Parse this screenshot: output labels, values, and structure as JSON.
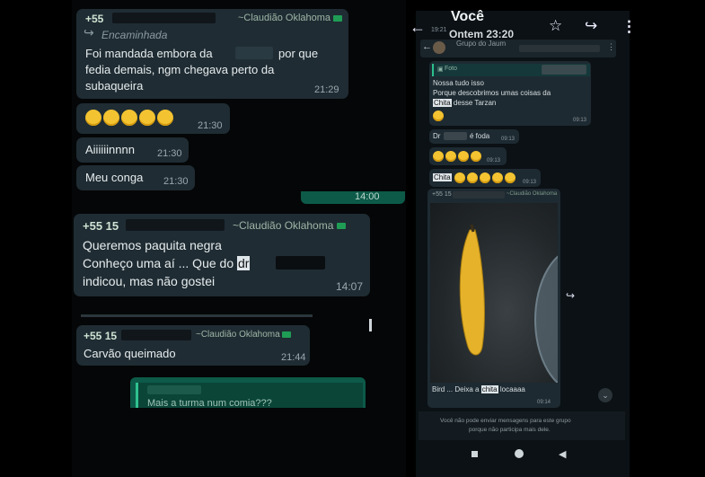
{
  "left_chat": {
    "msg1": {
      "sender": "+55",
      "contact": "~Claudião Oklahoma",
      "forwarded": "Encaminhada",
      "line1": "Foi mandada embora da",
      "line1_end": "por que",
      "line2": "fedia demais, ngm chegava perto da",
      "line3": "subaqueira",
      "time": "21:29"
    },
    "msg2": {
      "time": "21:30"
    },
    "msg3": {
      "text": "Aiiiiiinnnn",
      "time": "21:30"
    },
    "msg4": {
      "text": "Meu conga",
      "time": "21:30"
    },
    "msg_out_time": "14:00",
    "msg5": {
      "sender": "+55 15",
      "contact": "~Claudião Oklahoma",
      "line1": "Queremos paquita negra",
      "line2": "Conheço uma aí ... Que do",
      "line2_hl": "dr",
      "line3": "indicou, mas não gostei",
      "time": "14:07"
    },
    "msg6": {
      "sender": "+55 15",
      "contact": "~Claudião Oklahoma",
      "text": "Carvão queimado",
      "time": "21:44"
    },
    "msg7": {
      "text": "Mais a turma num comia???"
    }
  },
  "phone": {
    "title": "Você",
    "subtitle": "Ontem 23:20",
    "status_time": "19:21",
    "group_name": "Grupo do Jaum",
    "foto_label": "Foto",
    "m1_l1": "Nossa tudo isso",
    "m1_l2": "Porque descobrimos umas coisas da",
    "m1_hl": "Chita",
    "m1_l3": "desse Tarzan",
    "m1_time": "09:13",
    "m2_prefix": "Dr",
    "m2_text": "é foda",
    "m2_time": "09:13",
    "m3_time": "09:13",
    "m4_hl": "Chita",
    "m4_time": "09:13",
    "m5_sender": "+55 15",
    "m5_contact": "~Claudião Oklahoma",
    "m5_caption_a": "Bird ... Deixa a",
    "m5_caption_hl": "chita",
    "m5_caption_b": "locaaaa",
    "m5_time": "09:14",
    "footer_l1": "Você não pode enviar mensagens para este grupo",
    "footer_l2": "porque não participa mais dele.",
    "icons": [
      "back-arrow-icon",
      "star-icon",
      "forward-icon",
      "more-vert-icon"
    ]
  }
}
